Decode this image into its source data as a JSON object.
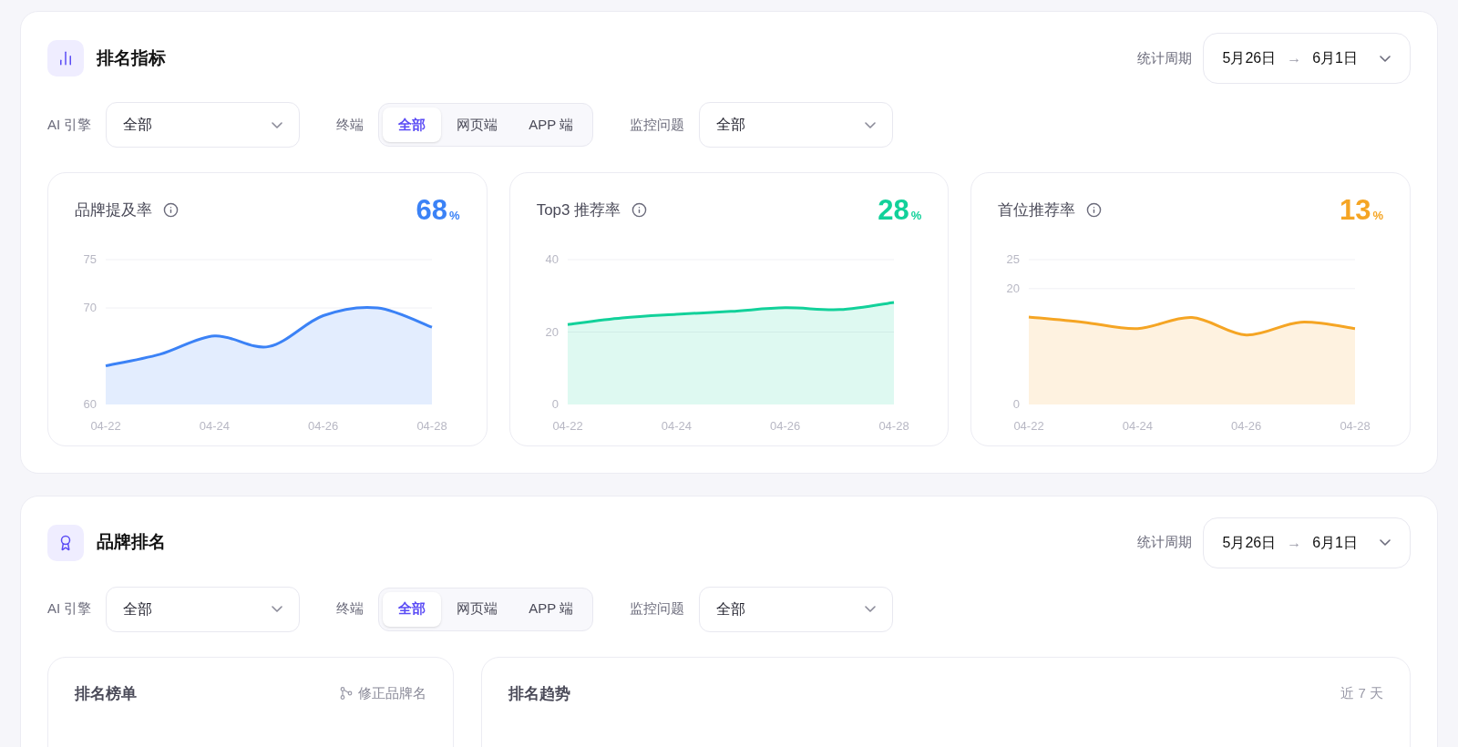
{
  "sections": [
    {
      "title": "排名指标",
      "period": {
        "label": "统计周期",
        "start": "5月26日",
        "arrow": "→",
        "end": "6月1日"
      },
      "filters": {
        "engine": {
          "label": "AI 引擎",
          "value": "全部"
        },
        "terminal": {
          "label": "终端",
          "tabs": [
            {
              "label": "全部",
              "selected": true
            },
            {
              "label": "网页端",
              "selected": false
            },
            {
              "label": "APP 端",
              "selected": false
            }
          ]
        },
        "question": {
          "label": "监控问题",
          "value": "全部"
        }
      },
      "metrics": [
        {
          "title": "品牌提及率",
          "value": "68",
          "unit": "%",
          "chart_data": {
            "type": "area",
            "categories": [
              "04-22",
              null,
              "04-24",
              null,
              "04-26",
              null,
              "04-28"
            ],
            "ylim": [
              60,
              75
            ],
            "yticks": [
              60,
              70,
              75
            ],
            "series": [
              {
                "color": "#3b82f6",
                "values": [
                  64,
                  65.2,
                  67.1,
                  66,
                  69.2,
                  70,
                  68
                ]
              }
            ]
          }
        },
        {
          "title": "Top3 推荐率",
          "value": "28",
          "unit": "%",
          "chart_data": {
            "type": "area",
            "categories": [
              "04-22",
              null,
              "04-24",
              null,
              "04-26",
              null,
              "04-28"
            ],
            "ylim": [
              0,
              40
            ],
            "yticks": [
              0,
              20,
              40
            ],
            "series": [
              {
                "color": "#12d19a",
                "values": [
                  22.1,
                  23.9,
                  24.9,
                  25.7,
                  26.7,
                  26.2,
                  28.2
                ]
              }
            ]
          }
        },
        {
          "title": "首位推荐率",
          "value": "13",
          "unit": "%",
          "chart_data": {
            "type": "area",
            "categories": [
              "04-22",
              null,
              "04-24",
              null,
              "04-26",
              null,
              "04-28"
            ],
            "ylim": [
              0,
              25
            ],
            "yticks": [
              0,
              20,
              25
            ],
            "series": [
              {
                "color": "#f5a524",
                "values": [
                  15.1,
                  14.2,
                  13.1,
                  15,
                  12,
                  14.2,
                  13.1
                ]
              }
            ]
          }
        }
      ]
    },
    {
      "title": "品牌排名",
      "period": {
        "label": "统计周期",
        "start": "5月26日",
        "arrow": "→",
        "end": "6月1日"
      },
      "filters": {
        "engine": {
          "label": "AI 引擎",
          "value": "全部"
        },
        "terminal": {
          "label": "终端",
          "tabs": [
            {
              "label": "全部",
              "selected": true
            },
            {
              "label": "网页端",
              "selected": false
            },
            {
              "label": "APP 端",
              "selected": false
            }
          ]
        },
        "question": {
          "label": "监控问题",
          "value": "全部"
        }
      },
      "panels": [
        {
          "title": "排名榜单",
          "action": "修正品牌名"
        },
        {
          "title": "排名趋势",
          "note": "近 7 天"
        }
      ]
    }
  ]
}
